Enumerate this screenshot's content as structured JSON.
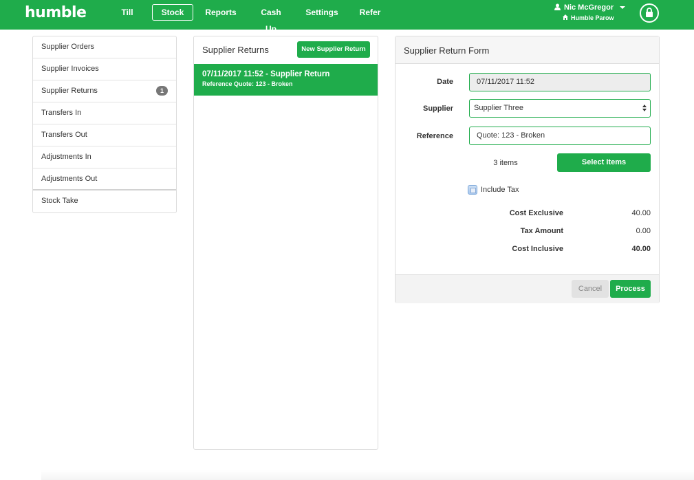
{
  "app": {
    "logo": "humble"
  },
  "nav": {
    "items": [
      {
        "label": "Till"
      },
      {
        "label": "Stock"
      },
      {
        "label": "Reports"
      },
      {
        "label": "Cash Up"
      },
      {
        "label": "Settings"
      },
      {
        "label": "Refer"
      }
    ],
    "active": "Stock",
    "user_name": "Nic McGregor",
    "store_name": "Humble Parow"
  },
  "sidebar": {
    "items": [
      {
        "label": "Supplier Orders"
      },
      {
        "label": "Supplier Invoices"
      },
      {
        "label": "Supplier Returns",
        "badge": "1"
      },
      {
        "label": "Transfers In"
      },
      {
        "label": "Transfers Out"
      },
      {
        "label": "Adjustments In"
      },
      {
        "label": "Adjustments Out"
      },
      {
        "label": "Stock Take"
      }
    ]
  },
  "returns_panel": {
    "title": "Supplier Returns",
    "new_button": "New Supplier Return",
    "items": [
      {
        "title": "07/11/2017 11:52 - Supplier Return",
        "subtitle": "Reference Quote: 123 - Broken"
      }
    ]
  },
  "form": {
    "title": "Supplier Return Form",
    "date_label": "Date",
    "date_value": "07/11/2017 11:52",
    "supplier_label": "Supplier",
    "supplier_value": "Supplier Three",
    "reference_label": "Reference",
    "reference_value": "Quote: 123 - Broken",
    "items_count": "3 items",
    "select_items_button": "Select Items",
    "include_tax_label": "Include Tax",
    "cost_exclusive_label": "Cost Exclusive",
    "cost_exclusive_value": "40.00",
    "tax_amount_label": "Tax Amount",
    "tax_amount_value": "0.00",
    "cost_inclusive_label": "Cost Inclusive",
    "cost_inclusive_value": "40.00",
    "cancel_button": "Cancel",
    "process_button": "Process"
  },
  "colors": {
    "brand_green": "#1fac4b",
    "badge_gray": "#777777"
  },
  "icons": {
    "user": "user-icon",
    "store": "home-icon",
    "lock": "lock-icon",
    "caret": "caret-down-icon"
  }
}
